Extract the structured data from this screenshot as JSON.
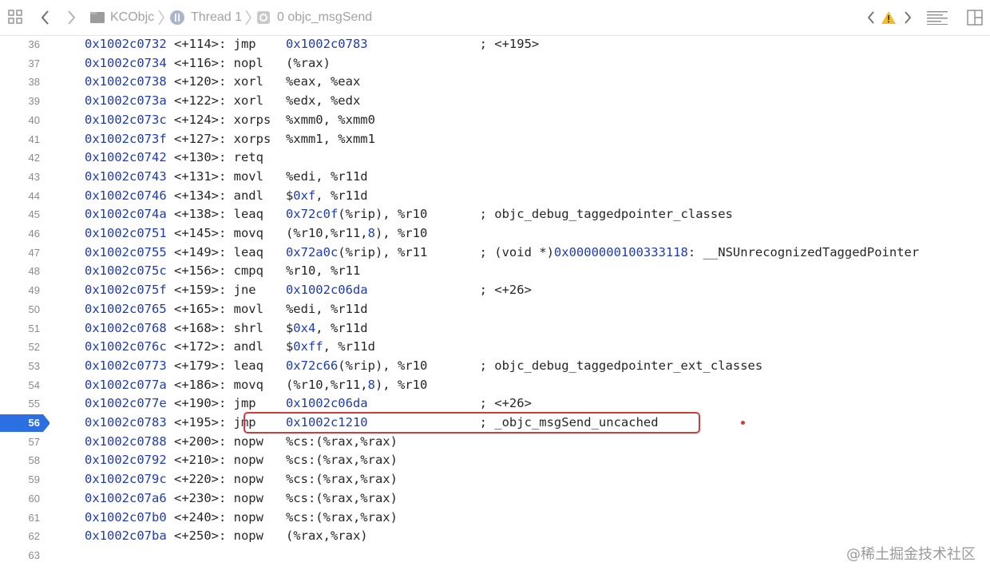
{
  "toolbar": {
    "breadcrumb": [
      {
        "label": "KCObjc",
        "icon": "folder-icon"
      },
      {
        "label": "Thread 1",
        "icon": "thread-icon"
      },
      {
        "label": "0 objc_msgSend",
        "icon": "gear-frame-icon"
      }
    ]
  },
  "colors": {
    "address": "#1e3bb6",
    "highlight_border": "#d33a3a",
    "current_line_marker": "#2b6fe3"
  },
  "current_line": 56,
  "lines": [
    {
      "n": "36",
      "parts": [
        {
          "t": "0x1002c0732",
          "c": "addr"
        },
        {
          "t": " <+114>: jmp    "
        },
        {
          "t": "0x1002c0783",
          "c": "addr"
        },
        {
          "t": "               ; <+195>"
        }
      ]
    },
    {
      "n": "37",
      "parts": [
        {
          "t": "0x1002c0734",
          "c": "addr"
        },
        {
          "t": " <+116>: nopl   (%rax)"
        }
      ]
    },
    {
      "n": "38",
      "parts": [
        {
          "t": "0x1002c0738",
          "c": "addr"
        },
        {
          "t": " <+120>: xorl   %eax, %eax"
        }
      ]
    },
    {
      "n": "39",
      "parts": [
        {
          "t": "0x1002c073a",
          "c": "addr"
        },
        {
          "t": " <+122>: xorl   %edx, %edx"
        }
      ]
    },
    {
      "n": "40",
      "parts": [
        {
          "t": "0x1002c073c",
          "c": "addr"
        },
        {
          "t": " <+124>: xorps  %xmm0, %xmm0"
        }
      ]
    },
    {
      "n": "41",
      "parts": [
        {
          "t": "0x1002c073f",
          "c": "addr"
        },
        {
          "t": " <+127>: xorps  %xmm1, %xmm1"
        }
      ]
    },
    {
      "n": "42",
      "parts": [
        {
          "t": "0x1002c0742",
          "c": "addr"
        },
        {
          "t": " <+130>: retq"
        }
      ]
    },
    {
      "n": "43",
      "parts": [
        {
          "t": "0x1002c0743",
          "c": "addr"
        },
        {
          "t": " <+131>: movl   %edi, %r11d"
        }
      ]
    },
    {
      "n": "44",
      "parts": [
        {
          "t": "0x1002c0746",
          "c": "addr"
        },
        {
          "t": " <+134>: andl   $"
        },
        {
          "t": "0xf",
          "c": "addr"
        },
        {
          "t": ", %r11d"
        }
      ]
    },
    {
      "n": "45",
      "parts": [
        {
          "t": "0x1002c074a",
          "c": "addr"
        },
        {
          "t": " <+138>: leaq   "
        },
        {
          "t": "0x72c0f",
          "c": "addr"
        },
        {
          "t": "(%rip), %r10       ; objc_debug_taggedpointer_classes"
        }
      ]
    },
    {
      "n": "46",
      "parts": [
        {
          "t": "0x1002c0751",
          "c": "addr"
        },
        {
          "t": " <+145>: movq   (%r10,%r11,"
        },
        {
          "t": "8",
          "c": "addr"
        },
        {
          "t": "), %r10"
        }
      ]
    },
    {
      "n": "47",
      "parts": [
        {
          "t": "0x1002c0755",
          "c": "addr"
        },
        {
          "t": " <+149>: leaq   "
        },
        {
          "t": "0x72a0c",
          "c": "addr"
        },
        {
          "t": "(%rip), %r11       ; (void *)"
        },
        {
          "t": "0x0000000100333118",
          "c": "addr"
        },
        {
          "t": ": __NSUnrecognizedTaggedPointer"
        }
      ]
    },
    {
      "n": "48",
      "parts": [
        {
          "t": "0x1002c075c",
          "c": "addr"
        },
        {
          "t": " <+156>: cmpq   %r10, %r11"
        }
      ]
    },
    {
      "n": "49",
      "parts": [
        {
          "t": "0x1002c075f",
          "c": "addr"
        },
        {
          "t": " <+159>: jne    "
        },
        {
          "t": "0x1002c06da",
          "c": "addr"
        },
        {
          "t": "               ; <+26>"
        }
      ]
    },
    {
      "n": "50",
      "parts": [
        {
          "t": "0x1002c0765",
          "c": "addr"
        },
        {
          "t": " <+165>: movl   %edi, %r11d"
        }
      ]
    },
    {
      "n": "51",
      "parts": [
        {
          "t": "0x1002c0768",
          "c": "addr"
        },
        {
          "t": " <+168>: shrl   $"
        },
        {
          "t": "0x4",
          "c": "addr"
        },
        {
          "t": ", %r11d"
        }
      ]
    },
    {
      "n": "52",
      "parts": [
        {
          "t": "0x1002c076c",
          "c": "addr"
        },
        {
          "t": " <+172>: andl   $"
        },
        {
          "t": "0xff",
          "c": "addr"
        },
        {
          "t": ", %r11d"
        }
      ]
    },
    {
      "n": "53",
      "parts": [
        {
          "t": "0x1002c0773",
          "c": "addr"
        },
        {
          "t": " <+179>: leaq   "
        },
        {
          "t": "0x72c66",
          "c": "addr"
        },
        {
          "t": "(%rip), %r10       ; objc_debug_taggedpointer_ext_classes"
        }
      ]
    },
    {
      "n": "54",
      "parts": [
        {
          "t": "0x1002c077a",
          "c": "addr"
        },
        {
          "t": " <+186>: movq   (%r10,%r11,"
        },
        {
          "t": "8",
          "c": "addr"
        },
        {
          "t": "), %r10"
        }
      ]
    },
    {
      "n": "55",
      "parts": [
        {
          "t": "0x1002c077e",
          "c": "addr"
        },
        {
          "t": " <+190>: jmp    "
        },
        {
          "t": "0x1002c06da",
          "c": "addr"
        },
        {
          "t": "               ; <+26>"
        }
      ]
    },
    {
      "n": "56",
      "parts": [
        {
          "t": "0x1002c0783",
          "c": "addr"
        },
        {
          "t": " <+195>: jmp    "
        },
        {
          "t": "0x1002c1210",
          "c": "addr"
        },
        {
          "t": "               ; _objc_msgSend_uncached"
        }
      ]
    },
    {
      "n": "57",
      "parts": [
        {
          "t": "0x1002c0788",
          "c": "addr"
        },
        {
          "t": " <+200>: nopw   %cs:(%rax,%rax)"
        }
      ]
    },
    {
      "n": "58",
      "parts": [
        {
          "t": "0x1002c0792",
          "c": "addr"
        },
        {
          "t": " <+210>: nopw   %cs:(%rax,%rax)"
        }
      ]
    },
    {
      "n": "59",
      "parts": [
        {
          "t": "0x1002c079c",
          "c": "addr"
        },
        {
          "t": " <+220>: nopw   %cs:(%rax,%rax)"
        }
      ]
    },
    {
      "n": "60",
      "parts": [
        {
          "t": "0x1002c07a6",
          "c": "addr"
        },
        {
          "t": " <+230>: nopw   %cs:(%rax,%rax)"
        }
      ]
    },
    {
      "n": "61",
      "parts": [
        {
          "t": "0x1002c07b0",
          "c": "addr"
        },
        {
          "t": " <+240>: nopw   %cs:(%rax,%rax)"
        }
      ]
    },
    {
      "n": "62",
      "parts": [
        {
          "t": "0x1002c07ba",
          "c": "addr"
        },
        {
          "t": " <+250>: nopw   (%rax,%rax)"
        }
      ]
    },
    {
      "n": "63",
      "parts": []
    }
  ],
  "watermark": "@稀土掘金技术社区"
}
